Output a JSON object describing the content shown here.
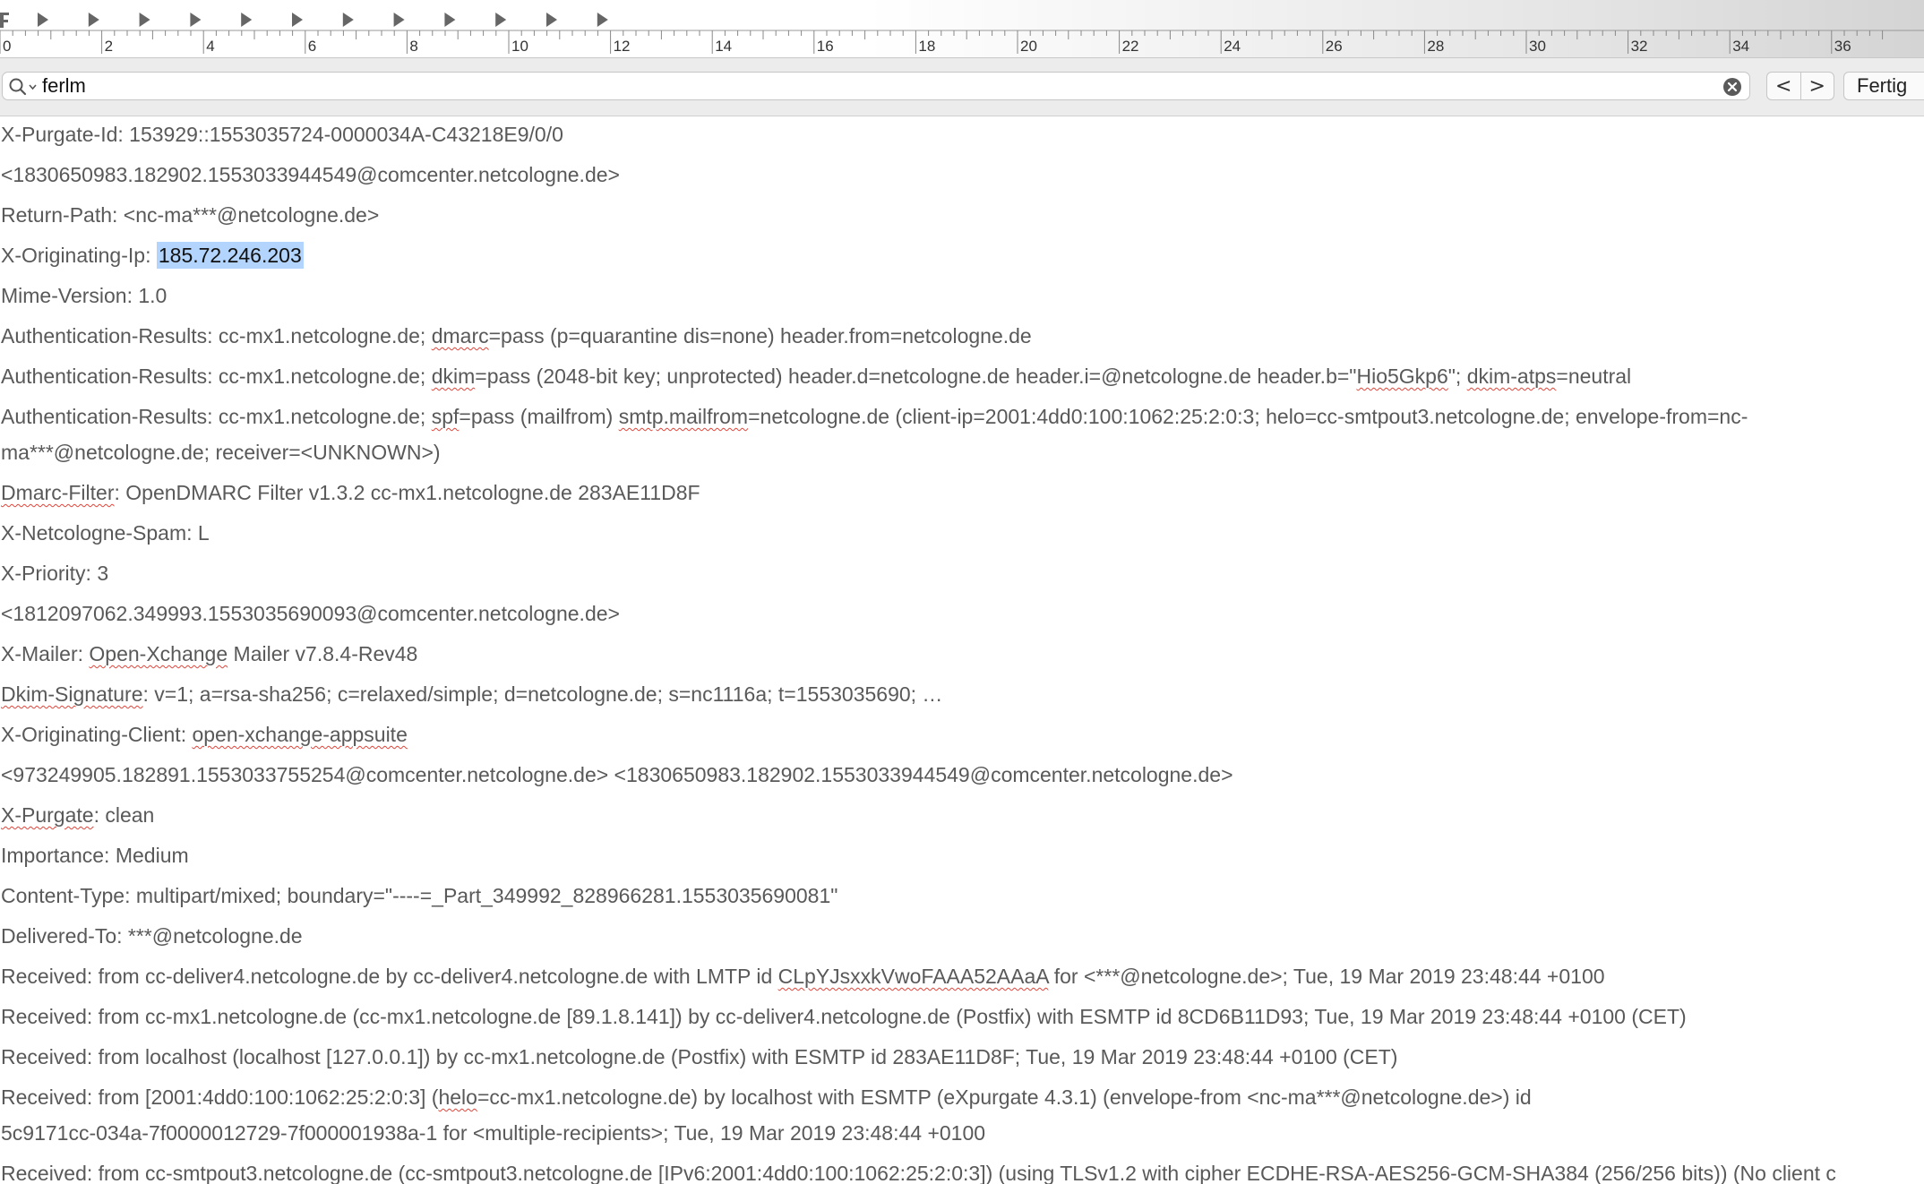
{
  "ruler": {
    "tab_stops": 12,
    "labels": [
      "0",
      "2",
      "4",
      "6",
      "8",
      "10",
      "12",
      "14",
      "16",
      "18",
      "20",
      "22",
      "24",
      "26",
      "28",
      "30",
      "32",
      "34",
      "36"
    ]
  },
  "find": {
    "query": "ferlm",
    "prev_label": "<",
    "next_label": ">",
    "done_label": "Fertig"
  },
  "headers": [
    {
      "segs": [
        {
          "t": "X-Purgate-Id: 153929::1553035724-0000034A-C43218E9/0/0"
        }
      ]
    },
    {
      "segs": [
        {
          "t": "<1830650983.182902.1553033944549@comcenter.netcologne.de>"
        }
      ]
    },
    {
      "segs": [
        {
          "t": "Return-Path: <nc-ma***@netcologne.de>"
        }
      ]
    },
    {
      "segs": [
        {
          "t": "X-Originating-Ip: "
        },
        {
          "t": "185.72.246.203",
          "hl": true
        }
      ]
    },
    {
      "segs": [
        {
          "t": "Mime-Version: 1.0"
        }
      ]
    },
    {
      "segs": [
        {
          "t": "Authentication-Results: cc-mx1.netcologne.de; "
        },
        {
          "t": "dmarc",
          "sp": true
        },
        {
          "t": "=pass (p=quarantine dis=none) header.from=netcologne.de"
        }
      ]
    },
    {
      "segs": [
        {
          "t": "Authentication-Results: cc-mx1.netcologne.de; "
        },
        {
          "t": "dkim",
          "sp": true
        },
        {
          "t": "=pass (2048-bit key; unprotected) header.d=netcologne.de header.i=@netcologne.de header.b=\""
        },
        {
          "t": "Hio5Gkp6",
          "sp": true
        },
        {
          "t": "\"; "
        },
        {
          "t": "dkim-atps",
          "sp": true
        },
        {
          "t": "=neutral"
        }
      ]
    },
    {
      "segs": [
        {
          "t": "Authentication-Results: cc-mx1.netcologne.de; "
        },
        {
          "t": "spf",
          "sp": true
        },
        {
          "t": "=pass (mailfrom) "
        },
        {
          "t": "smtp.mailfrom",
          "sp": true
        },
        {
          "t": "=netcologne.de (client-ip=2001:4dd0:100:1062:25:2:0:3; helo=cc-smtpout3.netcologne.de; envelope-from=nc-"
        }
      ],
      "cont": "ma***@netcologne.de; receiver=<UNKNOWN>)"
    },
    {
      "segs": [
        {
          "t": "Dmarc-Filter",
          "sp": true
        },
        {
          "t": ": OpenDMARC Filter v1.3.2 cc-mx1.netcologne.de 283AE11D8F"
        }
      ]
    },
    {
      "segs": [
        {
          "t": "X-Netcologne-Spam: L"
        }
      ]
    },
    {
      "segs": [
        {
          "t": "X-Priority: 3"
        }
      ]
    },
    {
      "segs": [
        {
          "t": "<1812097062.349993.1553035690093@comcenter.netcologne.de>"
        }
      ]
    },
    {
      "segs": [
        {
          "t": "X-Mailer: "
        },
        {
          "t": "Open-Xchange",
          "sp": true
        },
        {
          "t": " Mailer v7.8.4-Rev48"
        }
      ]
    },
    {
      "segs": [
        {
          "t": "Dkim-Signature",
          "sp": true
        },
        {
          "t": ": v=1; a=rsa-sha256; c=relaxed/simple; d=netcologne.de; s=nc1116a; t=1553035690; …"
        }
      ]
    },
    {
      "segs": [
        {
          "t": "X-Originating-Client: "
        },
        {
          "t": "open-xchange-appsuite",
          "sp": true
        }
      ]
    },
    {
      "segs": [
        {
          "t": "<973249905.182891.1553033755254@comcenter.netcologne.de> <1830650983.182902.1553033944549@comcenter.netcologne.de>"
        }
      ]
    },
    {
      "segs": [
        {
          "t": "X-Purgate",
          "sp": true
        },
        {
          "t": ": clean"
        }
      ]
    },
    {
      "segs": [
        {
          "t": "Importance: Medium"
        }
      ]
    },
    {
      "segs": [
        {
          "t": "Content-Type: multipart/mixed;  boundary=\"----=_Part_349992_828966281.1553035690081\""
        }
      ]
    },
    {
      "segs": [
        {
          "t": "Delivered-To: ***@netcologne.de"
        }
      ]
    },
    {
      "segs": [
        {
          "t": "Received: from cc-deliver4.netcologne.de by cc-deliver4.netcologne.de with LMTP id "
        },
        {
          "t": "CLpYJsxxkVwoFAAA52AAaA",
          "sp": true
        },
        {
          "t": " for <***@netcologne.de>; Tue, 19 Mar 2019 23:48:44 +0100"
        }
      ]
    },
    {
      "segs": [
        {
          "t": "Received: from cc-mx1.netcologne.de (cc-mx1.netcologne.de [89.1.8.141]) by cc-deliver4.netcologne.de (Postfix) with ESMTP id 8CD6B11D93; Tue, 19 Mar 2019 23:48:44 +0100 (CET)"
        }
      ]
    },
    {
      "segs": [
        {
          "t": "Received: from localhost (localhost [127.0.0.1]) by cc-mx1.netcologne.de (Postfix) with ESMTP id 283AE11D8F; Tue, 19 Mar 2019 23:48:44 +0100 (CET)"
        }
      ]
    },
    {
      "segs": [
        {
          "t": "Received: from [2001:4dd0:100:1062:25:2:0:3] ("
        },
        {
          "t": "helo",
          "sp": true
        },
        {
          "t": "=cc-mx1.netcologne.de) by localhost with ESMTP (eXpurgate 4.3.1) (envelope-from <nc-ma***@netcologne.de>) id"
        }
      ],
      "cont": "5c9171cc-034a-7f0000012729-7f000001938a-1 for <multiple-recipients>; Tue, 19 Mar 2019 23:48:44 +0100"
    },
    {
      "segs": [
        {
          "t": "Received: from cc-smtpout3.netcologne.de (cc-smtpout3.netcologne.de [IPv6:2001:4dd0:100:1062:25:2:0:3]) (using TLSv1.2 with cipher ECDHE-RSA-AES256-GCM-SHA384 (256/256 bits)) (No client c"
        }
      ]
    }
  ]
}
